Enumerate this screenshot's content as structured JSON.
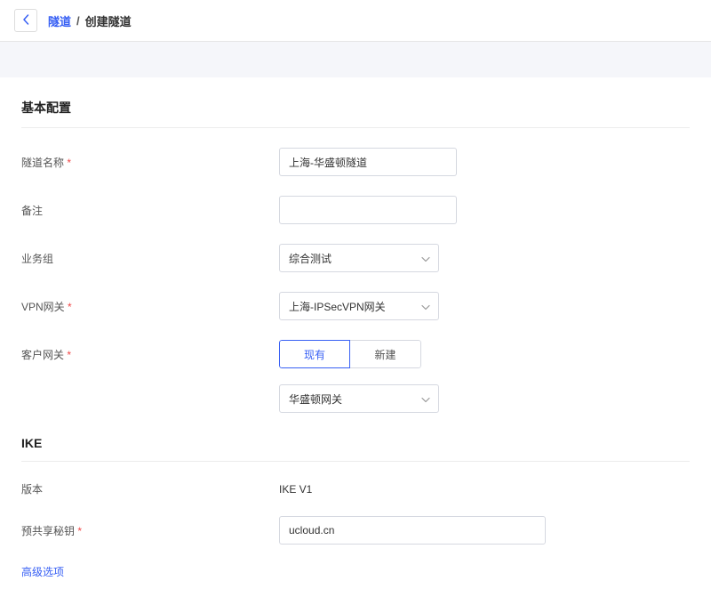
{
  "header": {
    "breadcrumb_link": "隧道",
    "breadcrumb_current": "创建隧道"
  },
  "basic": {
    "title": "基本配置",
    "tunnel_name_label": "隧道名称",
    "tunnel_name_value": "上海-华盛顿隧道",
    "remark_label": "备注",
    "remark_value": "",
    "business_group_label": "业务组",
    "business_group_value": "综合测试",
    "vpn_gateway_label": "VPN网关",
    "vpn_gateway_value": "上海-IPSecVPN网关",
    "customer_gateway_label": "客户网关",
    "seg_existing": "现有",
    "seg_new": "新建",
    "customer_gateway_value": "华盛顿网关"
  },
  "ike": {
    "title": "IKE",
    "version_label": "版本",
    "version_value": "IKE V1",
    "psk_label": "预共享秘钥",
    "psk_value": "ucloud.cn",
    "advanced_label": "高级选项"
  }
}
